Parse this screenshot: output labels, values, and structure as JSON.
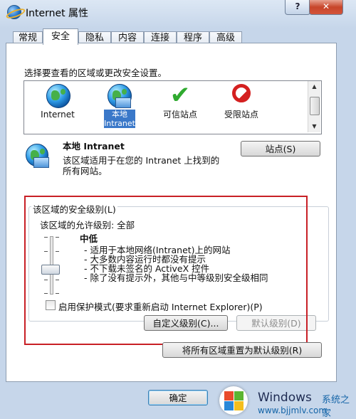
{
  "window": {
    "title": "Internet 属性",
    "help": "?",
    "close": "✕"
  },
  "tabs": [
    "常规",
    "安全",
    "隐私",
    "内容",
    "连接",
    "程序",
    "高级"
  ],
  "prompt": "选择要查看的区域或更改安全设置。",
  "zones": [
    {
      "label": "Internet",
      "icon": "globe-icon"
    },
    {
      "label": "本地\nIntranet",
      "icon": "intranet-globe-icon",
      "selected": true
    },
    {
      "label": "可信站点",
      "icon": "check-icon"
    },
    {
      "label": "受限站点",
      "icon": "no-entry-icon"
    }
  ],
  "selected_zone": {
    "name": "本地 Intranet",
    "description": "该区域适用于在您的 Intranet 上找到的所有网站。"
  },
  "sites_button": "站点(S)",
  "security_group": {
    "label": "该区域的安全级别(L)",
    "allowed_levels": "该区域的允许级别: 全部",
    "level_name": "中低",
    "level_position": 0.4,
    "bullets": [
      "- 适用于本地网络(Intranet)上的网站",
      "- 大多数内容运行时都没有提示",
      "- 不下载未签名的 ActiveX 控件",
      "- 除了没有提示外，其他与中等级别安全级相同"
    ],
    "protected_mode": {
      "label": "启用保护模式(要求重新启动 Internet Explorer)(P)",
      "checked": false
    },
    "custom_button": "自定义级别(C)...",
    "default_button": "默认级别(D)"
  },
  "reset_button": "将所有区域重置为默认级别(R)",
  "ok_button": "确定",
  "watermark": {
    "brand": "Windows",
    "cn": "系统之家",
    "url": "www.bjjmlv.com"
  },
  "colors": {
    "highlight": "#c82026",
    "selection": "#3a78c9"
  }
}
